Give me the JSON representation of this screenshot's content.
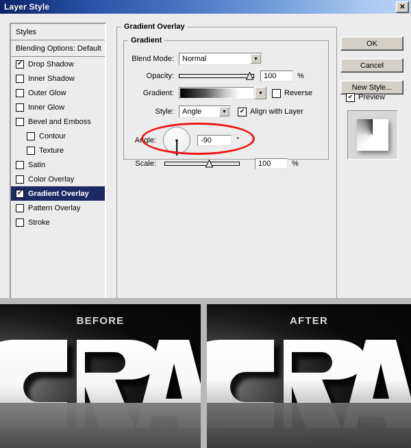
{
  "window": {
    "title": "Layer Style",
    "close_label": "✕"
  },
  "styles_panel": {
    "header": "Styles",
    "blending_options": "Blending Options: Default",
    "items": [
      {
        "label": "Drop Shadow",
        "checked": true,
        "indent": false,
        "selected": false
      },
      {
        "label": "Inner Shadow",
        "checked": false,
        "indent": false,
        "selected": false
      },
      {
        "label": "Outer Glow",
        "checked": false,
        "indent": false,
        "selected": false
      },
      {
        "label": "Inner Glow",
        "checked": false,
        "indent": false,
        "selected": false
      },
      {
        "label": "Bevel and Emboss",
        "checked": false,
        "indent": false,
        "selected": false
      },
      {
        "label": "Contour",
        "checked": false,
        "indent": true,
        "selected": false
      },
      {
        "label": "Texture",
        "checked": false,
        "indent": true,
        "selected": false
      },
      {
        "label": "Satin",
        "checked": false,
        "indent": false,
        "selected": false
      },
      {
        "label": "Color Overlay",
        "checked": false,
        "indent": false,
        "selected": false
      },
      {
        "label": "Gradient Overlay",
        "checked": true,
        "indent": false,
        "selected": true
      },
      {
        "label": "Pattern Overlay",
        "checked": false,
        "indent": false,
        "selected": false
      },
      {
        "label": "Stroke",
        "checked": false,
        "indent": false,
        "selected": false
      }
    ],
    "check_glyph": "✔"
  },
  "settings": {
    "group_title": "Gradient Overlay",
    "subgroup_title": "Gradient",
    "blend_mode": {
      "label": "Blend Mode:",
      "value": "Normal"
    },
    "opacity": {
      "label": "Opacity:",
      "value": "100",
      "unit": "%",
      "percent": 100
    },
    "gradient": {
      "label": "Gradient:",
      "reverse_label": "Reverse",
      "reverse_checked": false
    },
    "style": {
      "label": "Style:",
      "value": "Angle",
      "align_label": "Align with Layer",
      "align_checked": true
    },
    "angle": {
      "label": "Angle:",
      "value": "-90",
      "unit": "°",
      "degrees": -90
    },
    "scale": {
      "label": "Scale:",
      "value": "100",
      "unit": "%",
      "percent": 60
    },
    "dropdown_glyph": "▼",
    "check_glyph": "✔"
  },
  "buttons": {
    "ok": "OK",
    "cancel": "Cancel",
    "new_style": "New Style...",
    "preview_label": "Preview",
    "preview_checked": true,
    "check_glyph": "✔"
  },
  "comparison": {
    "before_label": "BEFORE",
    "after_label": "AFTER",
    "artwork_text": "CRA"
  },
  "colors": {
    "title_bar_start": "#0a246a",
    "title_bar_end": "#bcd4f6",
    "dialog_bg": "#ececec",
    "selection": "#1c2a63",
    "annotation": "#ee1111",
    "divider": "#b8b8b8"
  }
}
